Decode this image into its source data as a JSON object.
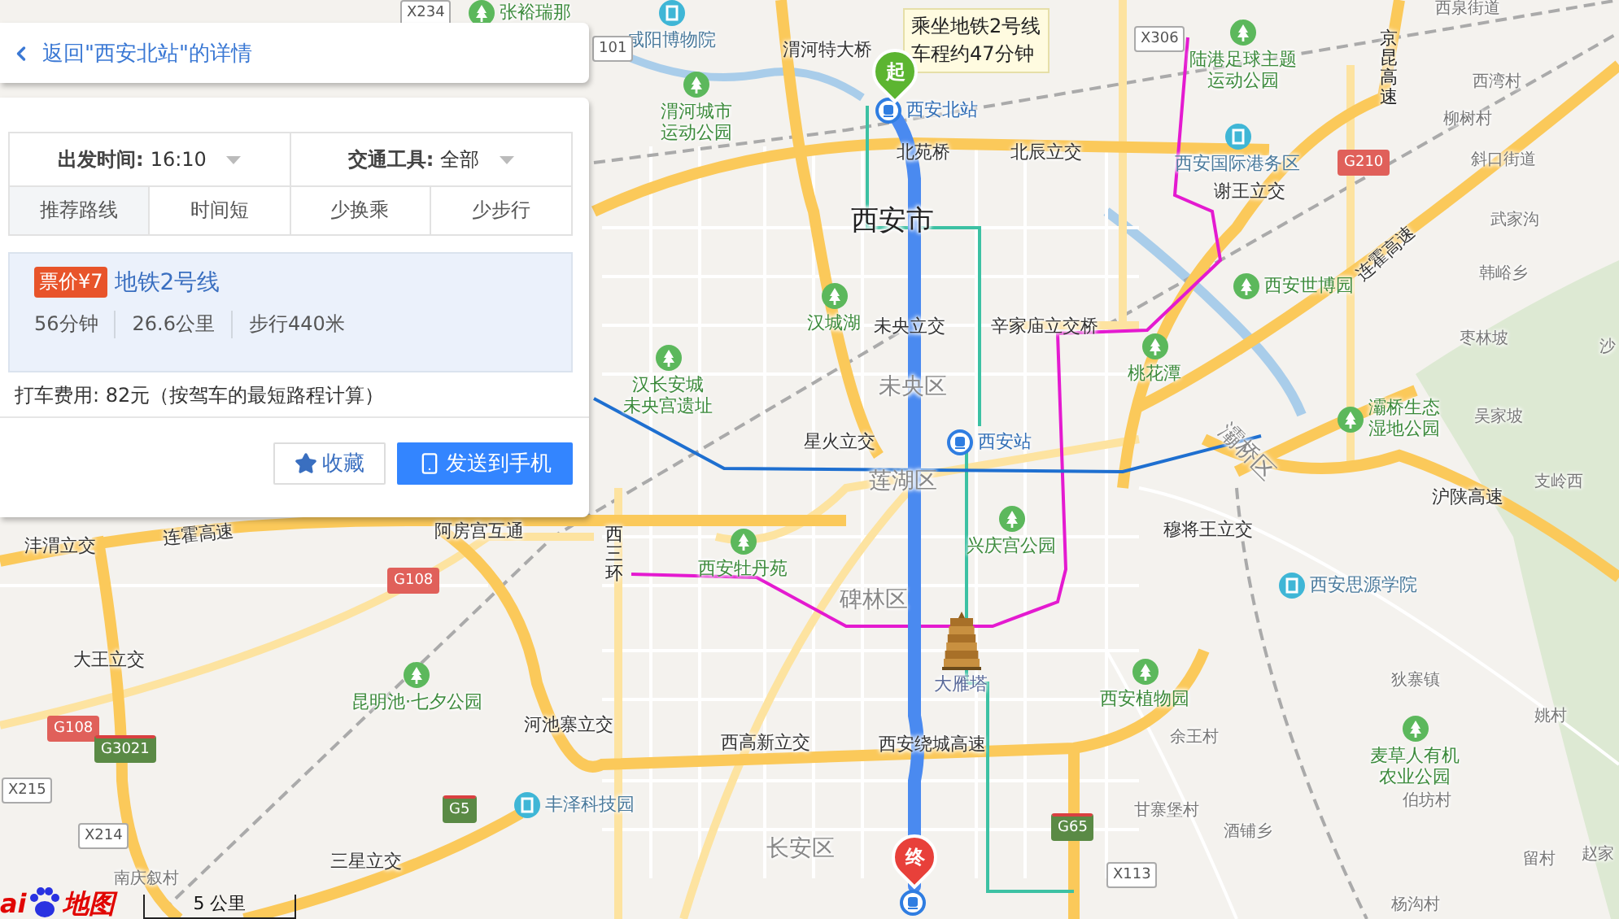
{
  "panel": {
    "back_link": "返回\"西安北站\"的详情",
    "filters": [
      {
        "label": "出发时间:",
        "value": "16:10"
      },
      {
        "label": "交通工具:",
        "value": "全部"
      }
    ],
    "tabs": [
      {
        "label": "推荐路线",
        "selected": true
      },
      {
        "label": "时间短",
        "selected": false
      },
      {
        "label": "少换乘",
        "selected": false
      },
      {
        "label": "少步行",
        "selected": false
      }
    ],
    "route": {
      "fare": "票价¥7",
      "line": "地铁2号线",
      "stats": [
        "56分钟",
        "26.6公里",
        "步行440米"
      ]
    },
    "taxi_note": "打车费用: 82元（按驾车的最短路程计算）",
    "buttons": [
      {
        "kind": "favorite",
        "label": "收藏"
      },
      {
        "kind": "send",
        "label": "发送到手机"
      }
    ]
  },
  "map": {
    "tooltip": [
      "乘坐地铁2号线",
      "车程约47分钟"
    ],
    "start_marker": "起",
    "end_marker": "终",
    "labels": [
      {
        "lines": [
          "张裕瑞那"
        ],
        "kind": "park_side"
      },
      {
        "lines": [
          "咸阳博物院"
        ],
        "kind": "poi_above"
      },
      {
        "lines": [
          "渭河特大桥"
        ],
        "kind": "place"
      },
      {
        "lines": [
          "渭河城市",
          "运动公园"
        ],
        "kind": "park"
      },
      {
        "lines": [
          "西安北站"
        ],
        "kind": "station"
      },
      {
        "lines": [
          "北苑桥"
        ],
        "kind": "place"
      },
      {
        "lines": [
          "北辰立交"
        ],
        "kind": "place"
      },
      {
        "lines": [
          "西安市"
        ],
        "kind": "city"
      },
      {
        "lines": [
          "汉城湖"
        ],
        "kind": "park"
      },
      {
        "lines": [
          "未央立交"
        ],
        "kind": "place"
      },
      {
        "lines": [
          "辛家庙立交桥"
        ],
        "kind": "place"
      },
      {
        "lines": [
          "汉长安城",
          "未央宫遗址"
        ],
        "kind": "park"
      },
      {
        "lines": [
          "未央区"
        ],
        "kind": "district"
      },
      {
        "lines": [
          "星火立交"
        ],
        "kind": "place"
      },
      {
        "lines": [
          "西安站"
        ],
        "kind": "station"
      },
      {
        "lines": [
          "莲湖区"
        ],
        "kind": "district"
      },
      {
        "lines": [
          "西三环"
        ],
        "kind": "vertical"
      },
      {
        "lines": [
          "西安牡丹苑"
        ],
        "kind": "park"
      },
      {
        "lines": [
          "兴庆宫公园"
        ],
        "kind": "park"
      },
      {
        "lines": [
          "碑林区"
        ],
        "kind": "district"
      },
      {
        "lines": [
          "大雁塔"
        ],
        "kind": "landmark"
      },
      {
        "lines": [
          "西高新立交"
        ],
        "kind": "place"
      },
      {
        "lines": [
          "西安绕城高速"
        ],
        "kind": "place"
      },
      {
        "lines": [
          "长安区"
        ],
        "kind": "district"
      },
      {
        "lines": [
          "丰泽科技园"
        ],
        "kind": "poi"
      },
      {
        "lines": [
          "河池寨立交"
        ],
        "kind": "place"
      },
      {
        "lines": [
          "三星立交"
        ],
        "kind": "place"
      },
      {
        "lines": [
          "昆明池·七夕公园"
        ],
        "kind": "park"
      },
      {
        "lines": [
          "大王立交"
        ],
        "kind": "place"
      },
      {
        "lines": [
          "沣渭立交"
        ],
        "kind": "place"
      },
      {
        "lines": [
          "阿房宫互通"
        ],
        "kind": "place"
      },
      {
        "lines": [
          "连霍高速"
        ],
        "kind": "highway"
      },
      {
        "lines": [
          "南庆叙村"
        ],
        "kind": "village"
      },
      {
        "lines": [
          "陆港足球主题",
          "运动公园"
        ],
        "kind": "park"
      },
      {
        "lines": [
          "西安国际港务区"
        ],
        "kind": "poi_above"
      },
      {
        "lines": [
          "谢王立交"
        ],
        "kind": "place"
      },
      {
        "lines": [
          "京昆高速"
        ],
        "kind": "vertical"
      },
      {
        "lines": [
          "西泉街道"
        ],
        "kind": "village"
      },
      {
        "lines": [
          "西湾村"
        ],
        "kind": "village"
      },
      {
        "lines": [
          "柳树村"
        ],
        "kind": "village"
      },
      {
        "lines": [
          "斜口街道"
        ],
        "kind": "village"
      },
      {
        "lines": [
          "连霍高速"
        ],
        "kind": "highway"
      },
      {
        "lines": [
          "武家沟"
        ],
        "kind": "village"
      },
      {
        "lines": [
          "韩峪乡"
        ],
        "kind": "village"
      },
      {
        "lines": [
          "西安世博园"
        ],
        "kind": "park_side"
      },
      {
        "lines": [
          "枣林坡"
        ],
        "kind": "village"
      },
      {
        "lines": [
          "沙"
        ],
        "kind": "village"
      },
      {
        "lines": [
          "桃花潭"
        ],
        "kind": "park"
      },
      {
        "lines": [
          "灞桥生态",
          "湿地公园"
        ],
        "kind": "park_side"
      },
      {
        "lines": [
          "吴家坡"
        ],
        "kind": "village"
      },
      {
        "lines": [
          "灞桥区"
        ],
        "kind": "district"
      },
      {
        "lines": [
          "沪陕高速"
        ],
        "kind": "highway"
      },
      {
        "lines": [
          "支岭西"
        ],
        "kind": "village"
      },
      {
        "lines": [
          "穆将王立交"
        ],
        "kind": "place"
      },
      {
        "lines": [
          "西安思源学院"
        ],
        "kind": "poi"
      },
      {
        "lines": [
          "狄寨镇"
        ],
        "kind": "village"
      },
      {
        "lines": [
          "姚村"
        ],
        "kind": "village"
      },
      {
        "lines": [
          "麦草人有机",
          "农业公园"
        ],
        "kind": "park"
      },
      {
        "lines": [
          "伯坊村"
        ],
        "kind": "village"
      },
      {
        "lines": [
          "余王村"
        ],
        "kind": "village"
      },
      {
        "lines": [
          "甘寨堡村"
        ],
        "kind": "village"
      },
      {
        "lines": [
          "酒铺乡"
        ],
        "kind": "village"
      },
      {
        "lines": [
          "留村"
        ],
        "kind": "village"
      },
      {
        "lines": [
          "赵家"
        ],
        "kind": "village"
      },
      {
        "lines": [
          "杨沟村"
        ],
        "kind": "village"
      },
      {
        "lines": [
          "西安植物园"
        ],
        "kind": "park"
      }
    ],
    "shields": [
      {
        "text": "X234",
        "kind": "county"
      },
      {
        "text": "101",
        "kind": "county"
      },
      {
        "text": "X306",
        "kind": "county"
      },
      {
        "text": "G210",
        "kind": "national"
      },
      {
        "text": "G108",
        "kind": "national"
      },
      {
        "text": "G108",
        "kind": "national"
      },
      {
        "text": "G3021",
        "kind": "expressway"
      },
      {
        "text": "X215",
        "kind": "county"
      },
      {
        "text": "X214",
        "kind": "county"
      },
      {
        "text": "G5",
        "kind": "expressway"
      },
      {
        "text": "G65",
        "kind": "expressway"
      },
      {
        "text": "X113",
        "kind": "county"
      }
    ],
    "logo": {
      "latin": "ai",
      "chinese": "地图"
    },
    "scale": "5 公里"
  }
}
